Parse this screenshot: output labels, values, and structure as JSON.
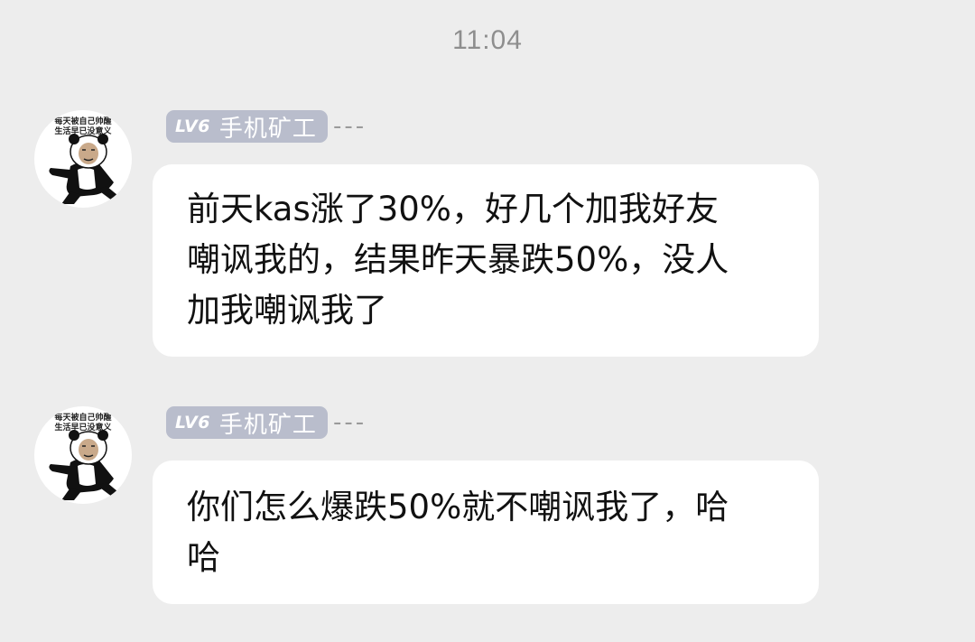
{
  "timestamp": "11:04",
  "colors": {
    "background": "#ededed",
    "bubble": "#ffffff",
    "badge": "#b9bdcc",
    "timestamp": "#8e8e8e"
  },
  "messages": [
    {
      "sender": {
        "level": "LV6",
        "name": "手机矿工",
        "suffix": "---",
        "avatar_caption_line1": "每天被自己帅醒",
        "avatar_caption_line2": "生活早已没意义",
        "avatar_icon": "panda-meme-avatar"
      },
      "text": "前天kas涨了30%，好几个加我好友嘲讽我的，结果昨天暴跌50%，没人加我嘲讽我了"
    },
    {
      "sender": {
        "level": "LV6",
        "name": "手机矿工",
        "suffix": "---",
        "avatar_caption_line1": "每天被自己帅醒",
        "avatar_caption_line2": "生活早已没意义",
        "avatar_icon": "panda-meme-avatar"
      },
      "text": "你们怎么爆跌50%就不嘲讽我了，哈哈"
    }
  ]
}
